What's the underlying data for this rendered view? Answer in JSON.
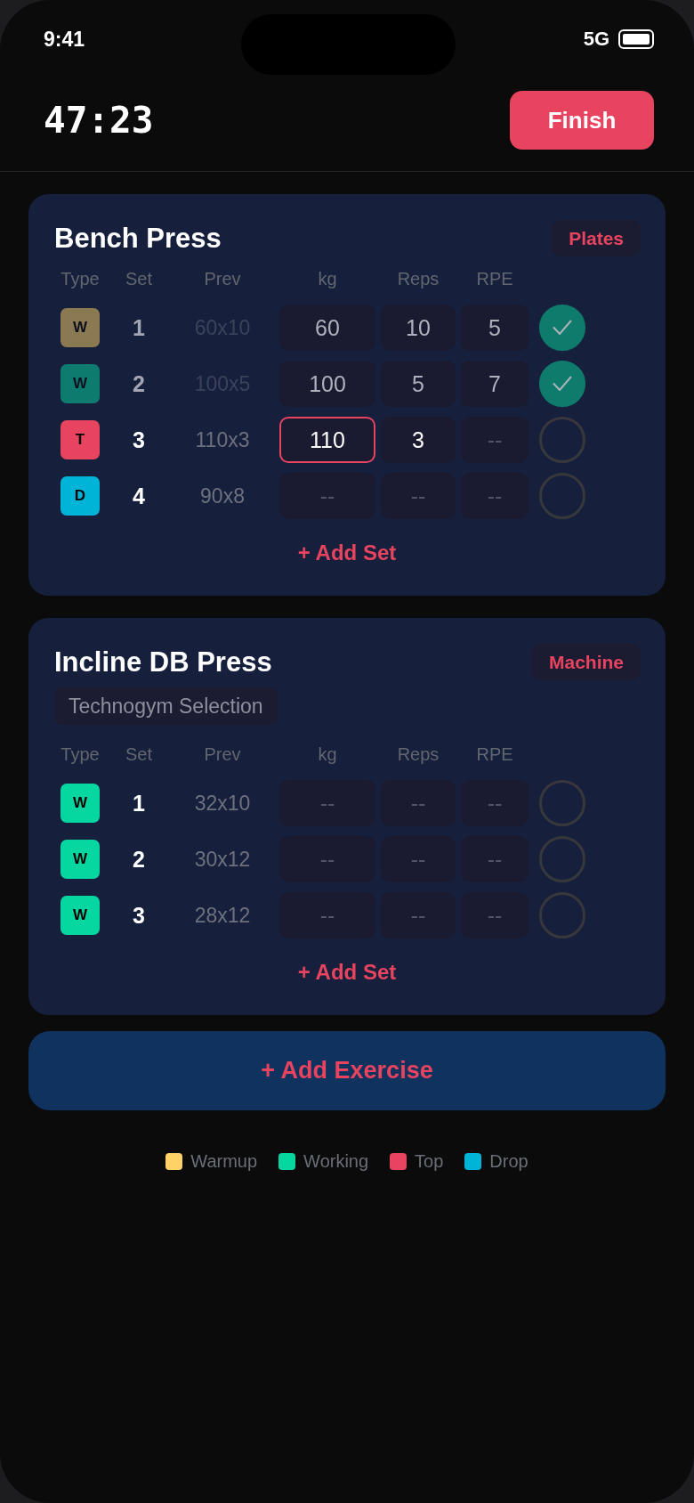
{
  "status_bar": {
    "time": "9:41",
    "network": "5G"
  },
  "header": {
    "timer": "47:23",
    "finish_button": "Finish"
  },
  "exercises": [
    {
      "name": "Bench Press",
      "tag": "Plates",
      "columns": [
        "Type",
        "Set",
        "Prev",
        "kg",
        "Reps",
        "RPE"
      ],
      "sets": [
        {
          "kind": "warmup",
          "badge": "W",
          "number": "1",
          "prev": "60x10",
          "fields": [
            {
              "value": "60",
              "focused": false
            },
            {
              "value": "10",
              "focused": false
            },
            {
              "value": "5",
              "focused": false
            }
          ],
          "done": true
        },
        {
          "kind": "working",
          "badge": "W",
          "number": "2",
          "prev": "100x5",
          "fields": [
            {
              "value": "100",
              "focused": false
            },
            {
              "value": "5",
              "focused": false
            },
            {
              "value": "7",
              "focused": false
            }
          ],
          "done": true
        },
        {
          "kind": "top",
          "badge": "T",
          "number": "3",
          "prev": "110x3",
          "fields": [
            {
              "value": "110",
              "focused": true
            },
            {
              "value": "3",
              "focused": false
            },
            {
              "placeholder": "--",
              "focused": false
            }
          ],
          "done": false
        },
        {
          "kind": "drop",
          "badge": "D",
          "number": "4",
          "prev": "90x8",
          "fields": [
            {
              "placeholder": "--",
              "focused": false
            },
            {
              "placeholder": "--",
              "focused": false
            },
            {
              "placeholder": "--",
              "focused": false
            }
          ],
          "done": false
        }
      ],
      "add_set": "+ Add Set"
    },
    {
      "name": "Incline DB Press",
      "tag": "Machine",
      "subtitle": "Technogym Selection",
      "columns": [
        "Type",
        "Set",
        "Prev",
        "kg",
        "Reps",
        "RPE"
      ],
      "sets": [
        {
          "kind": "working",
          "badge": "W",
          "number": "1",
          "prev": "32x10",
          "fields": [
            {
              "placeholder": "--",
              "focused": false
            },
            {
              "placeholder": "--",
              "focused": false
            },
            {
              "placeholder": "--",
              "focused": false
            }
          ],
          "done": false
        },
        {
          "kind": "working",
          "badge": "W",
          "number": "2",
          "prev": "30x12",
          "fields": [
            {
              "placeholder": "--",
              "focused": false
            },
            {
              "placeholder": "--",
              "focused": false
            },
            {
              "placeholder": "--",
              "focused": false
            }
          ],
          "done": false
        },
        {
          "kind": "working",
          "badge": "W",
          "number": "3",
          "prev": "28x12",
          "fields": [
            {
              "placeholder": "--",
              "focused": false
            },
            {
              "placeholder": "--",
              "focused": false
            },
            {
              "placeholder": "--",
              "focused": false
            }
          ],
          "done": false
        }
      ],
      "add_set": "+ Add Set"
    }
  ],
  "add_exercise": "+ Add Exercise",
  "legend": [
    {
      "kind": "warmup",
      "label": "Warmup",
      "color": "#ffd166"
    },
    {
      "kind": "working",
      "label": "Working",
      "color": "#06d6a0"
    },
    {
      "kind": "top",
      "label": "Top",
      "color": "#e8435f"
    },
    {
      "kind": "drop",
      "label": "Drop",
      "color": "#00b4d8"
    }
  ]
}
